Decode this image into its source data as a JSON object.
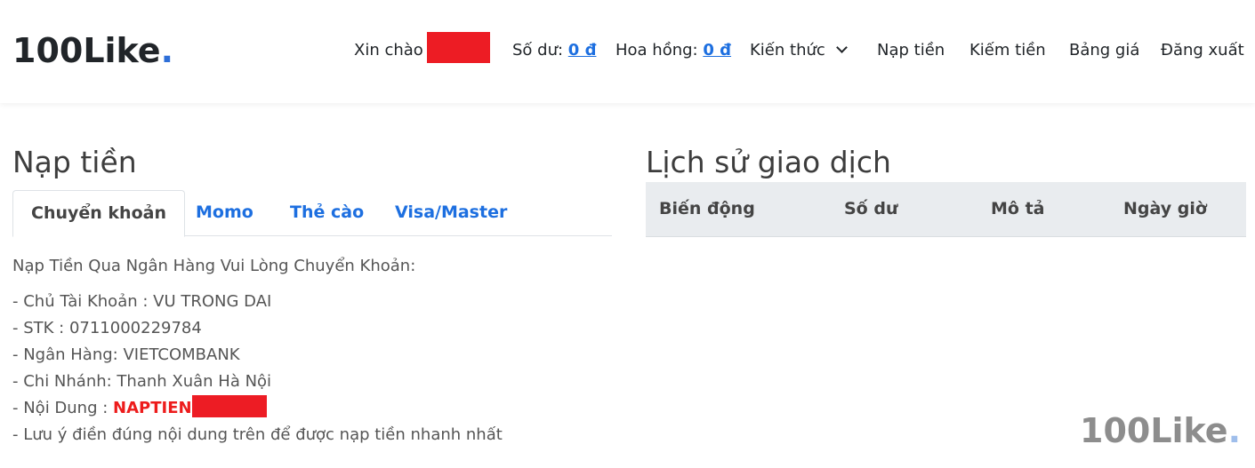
{
  "header": {
    "logo_text": "100Like",
    "logo_dot": ".",
    "greeting": "Xin chào",
    "balance_label": "Số dư: ",
    "balance_value": "0 đ",
    "commission_label": "Hoa hồng: ",
    "commission_value": "0 đ",
    "knowledge": "Kiến thức",
    "deposit": "Nạp tiền",
    "earn": "Kiếm tiền",
    "pricing": "Bảng giá",
    "logout": "Đăng xuất"
  },
  "deposit_panel": {
    "title": "Nạp tiền",
    "tabs": [
      "Chuyển khoản",
      "Momo",
      "Thẻ cào",
      "Visa/Master"
    ],
    "intro": "Nạp Tiền Qua Ngân Hàng Vui Lòng Chuyển Khoản:",
    "owner": "- Chủ Tài Khoản : VU TRONG DAI",
    "account": "- STK : 0711000229784",
    "bank": "- Ngân Hàng: VIETCOMBANK",
    "branch": "- Chi Nhánh: Thanh Xuân Hà Nội",
    "content_label": "- Nội Dung : ",
    "content_code": "NAPTIEN",
    "note": "- Lưu ý điền đúng nội dung trên để được nạp tiền nhanh nhất"
  },
  "history_panel": {
    "title": "Lịch sử giao dịch",
    "columns": [
      "Biến động",
      "Số dư",
      "Mô tả",
      "Ngày giờ"
    ]
  },
  "watermark": {
    "text": "100Like",
    "dot": "."
  },
  "colors": {
    "accent": "#1d6fe0",
    "redaction": "#ed1c24",
    "table_header_bg": "#e9ecef"
  }
}
